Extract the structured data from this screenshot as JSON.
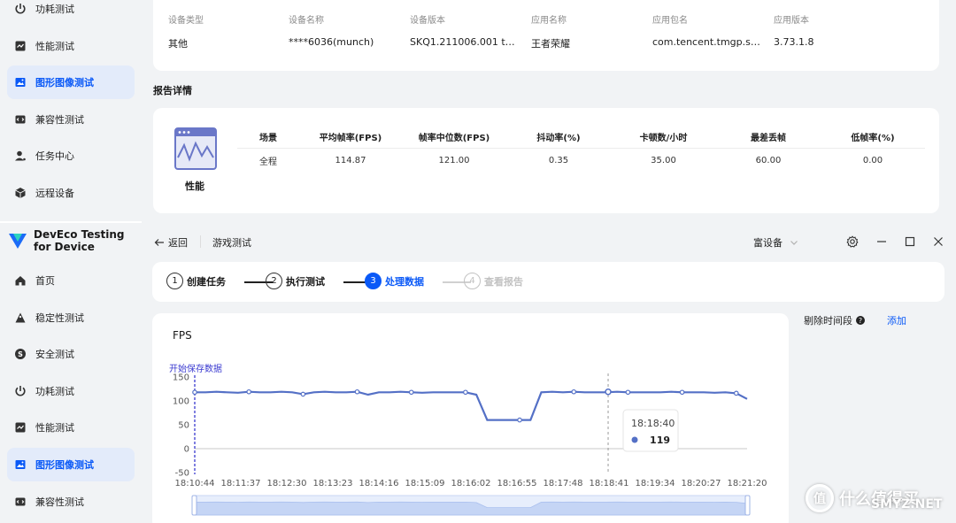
{
  "sidebar_top": {
    "items": [
      {
        "label": "功耗测试",
        "icon": "power-icon"
      },
      {
        "label": "性能测试",
        "icon": "performance-icon"
      },
      {
        "label": "图形图像测试",
        "icon": "image-icon",
        "active": true
      },
      {
        "label": "兼容性测试",
        "icon": "compatibility-icon"
      },
      {
        "label": "任务中心",
        "icon": "task-icon"
      },
      {
        "label": "远程设备",
        "icon": "remote-device-icon"
      }
    ]
  },
  "brand": {
    "line1": "DevEco Testing",
    "line2": "for Device"
  },
  "sidebar_bottom": {
    "items": [
      {
        "label": "首页",
        "icon": "home-icon"
      },
      {
        "label": "稳定性测试",
        "icon": "stability-icon"
      },
      {
        "label": "安全测试",
        "icon": "security-icon"
      },
      {
        "label": "功耗测试",
        "icon": "power-icon"
      },
      {
        "label": "性能测试",
        "icon": "performance-icon"
      },
      {
        "label": "图形图像测试",
        "icon": "image-icon",
        "active": true
      },
      {
        "label": "兼容性测试",
        "icon": "compatibility-icon"
      }
    ]
  },
  "device_info": {
    "columns": [
      {
        "label": "设备类型",
        "value": "其他"
      },
      {
        "label": "设备名称",
        "value": "****6036(munch)"
      },
      {
        "label": "设备版本",
        "value": "SKQ1.211006.001 tes..."
      },
      {
        "label": "应用名称",
        "value": "王者荣耀"
      },
      {
        "label": "应用包名",
        "value": "com.tencent.tmgp.sg..."
      },
      {
        "label": "应用版本",
        "value": "3.73.1.8"
      }
    ]
  },
  "report": {
    "title": "报告详情",
    "category": "性能",
    "headers": [
      "场景",
      "平均帧率(FPS)",
      "帧率中位数(FPS)",
      "抖动率(%)",
      "卡顿数/小时",
      "最差丢帧",
      "低帧率(%)"
    ],
    "row": [
      "全程",
      "114.87",
      "121.00",
      "0.35",
      "35.00",
      "60.00",
      "0.00"
    ]
  },
  "topbar": {
    "back_label": "返回",
    "title": "游戏测试",
    "device_select": "富设备"
  },
  "steps": [
    {
      "num": "1",
      "label": "创建任务",
      "state": "done"
    },
    {
      "num": "2",
      "label": "执行测试",
      "state": "done"
    },
    {
      "num": "3",
      "label": "处理数据",
      "state": "active"
    },
    {
      "num": "4",
      "label": "查看报告",
      "state": "pending"
    }
  ],
  "right_panel": {
    "label": "剔除时间段",
    "help": "?",
    "add_label": "添加"
  },
  "colors": {
    "accent": "#0a59f7",
    "line": "#5470c6",
    "active_bg": "#e3ebfa"
  },
  "chart_data": {
    "type": "line",
    "title": "FPS",
    "marker_label": "开始保存数据",
    "ylim": [
      -50,
      150
    ],
    "yticks": [
      "150",
      "100",
      "50",
      "0",
      "-50"
    ],
    "xticks": [
      "18:10:44",
      "18:11:37",
      "18:12:30",
      "18:13:23",
      "18:14:16",
      "18:15:09",
      "18:16:02",
      "18:16:55",
      "18:17:48",
      "18:18:41",
      "18:19:34",
      "18:20:27",
      "18:21:20"
    ],
    "series": [
      {
        "values": [
          118,
          118,
          119,
          118,
          117,
          119,
          118,
          118,
          119,
          118,
          114,
          118,
          119,
          118,
          118,
          119,
          113,
          118,
          118,
          119,
          118,
          117,
          118,
          118,
          118,
          118,
          113,
          60,
          60,
          60,
          60,
          60,
          118,
          119,
          118,
          119,
          118,
          118,
          118,
          119,
          118,
          118,
          118,
          118,
          119,
          118,
          118,
          118,
          117,
          118,
          116,
          104
        ]
      }
    ],
    "tooltip": {
      "time": "18:18:40",
      "value": "119"
    }
  },
  "watermark": {
    "text": "什么值得买",
    "sub": "SMYZ.NET"
  }
}
